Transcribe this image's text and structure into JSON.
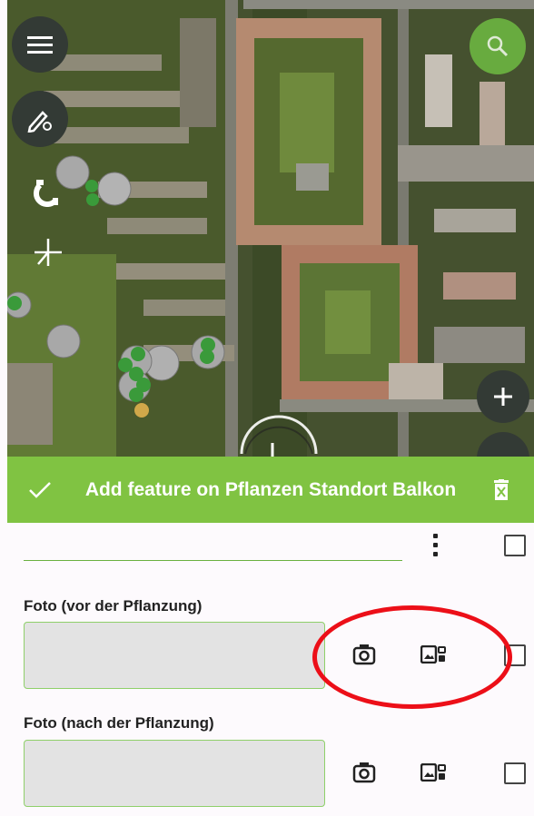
{
  "header": {
    "title": "Add feature on Pflanzen Standort Balkon",
    "accent_color": "#80c342"
  },
  "map_controls": {
    "menu_icon": "hamburger-menu-icon",
    "edit_icon": "pencil-gear-icon",
    "snap_icon": "magnet-icon",
    "digitize_icon": "crosshair-node-icon",
    "search_icon": "search-icon",
    "zoom_in_icon": "plus-icon"
  },
  "form": {
    "fields": [
      {
        "label": "Foto (vor der Pflanzung)",
        "value": ""
      },
      {
        "label": "Foto (nach der Pflanzung)",
        "value": ""
      }
    ],
    "camera_icon": "camera-icon",
    "gallery_icon": "gallery-icon",
    "annotation_color": "#ec0f18"
  }
}
